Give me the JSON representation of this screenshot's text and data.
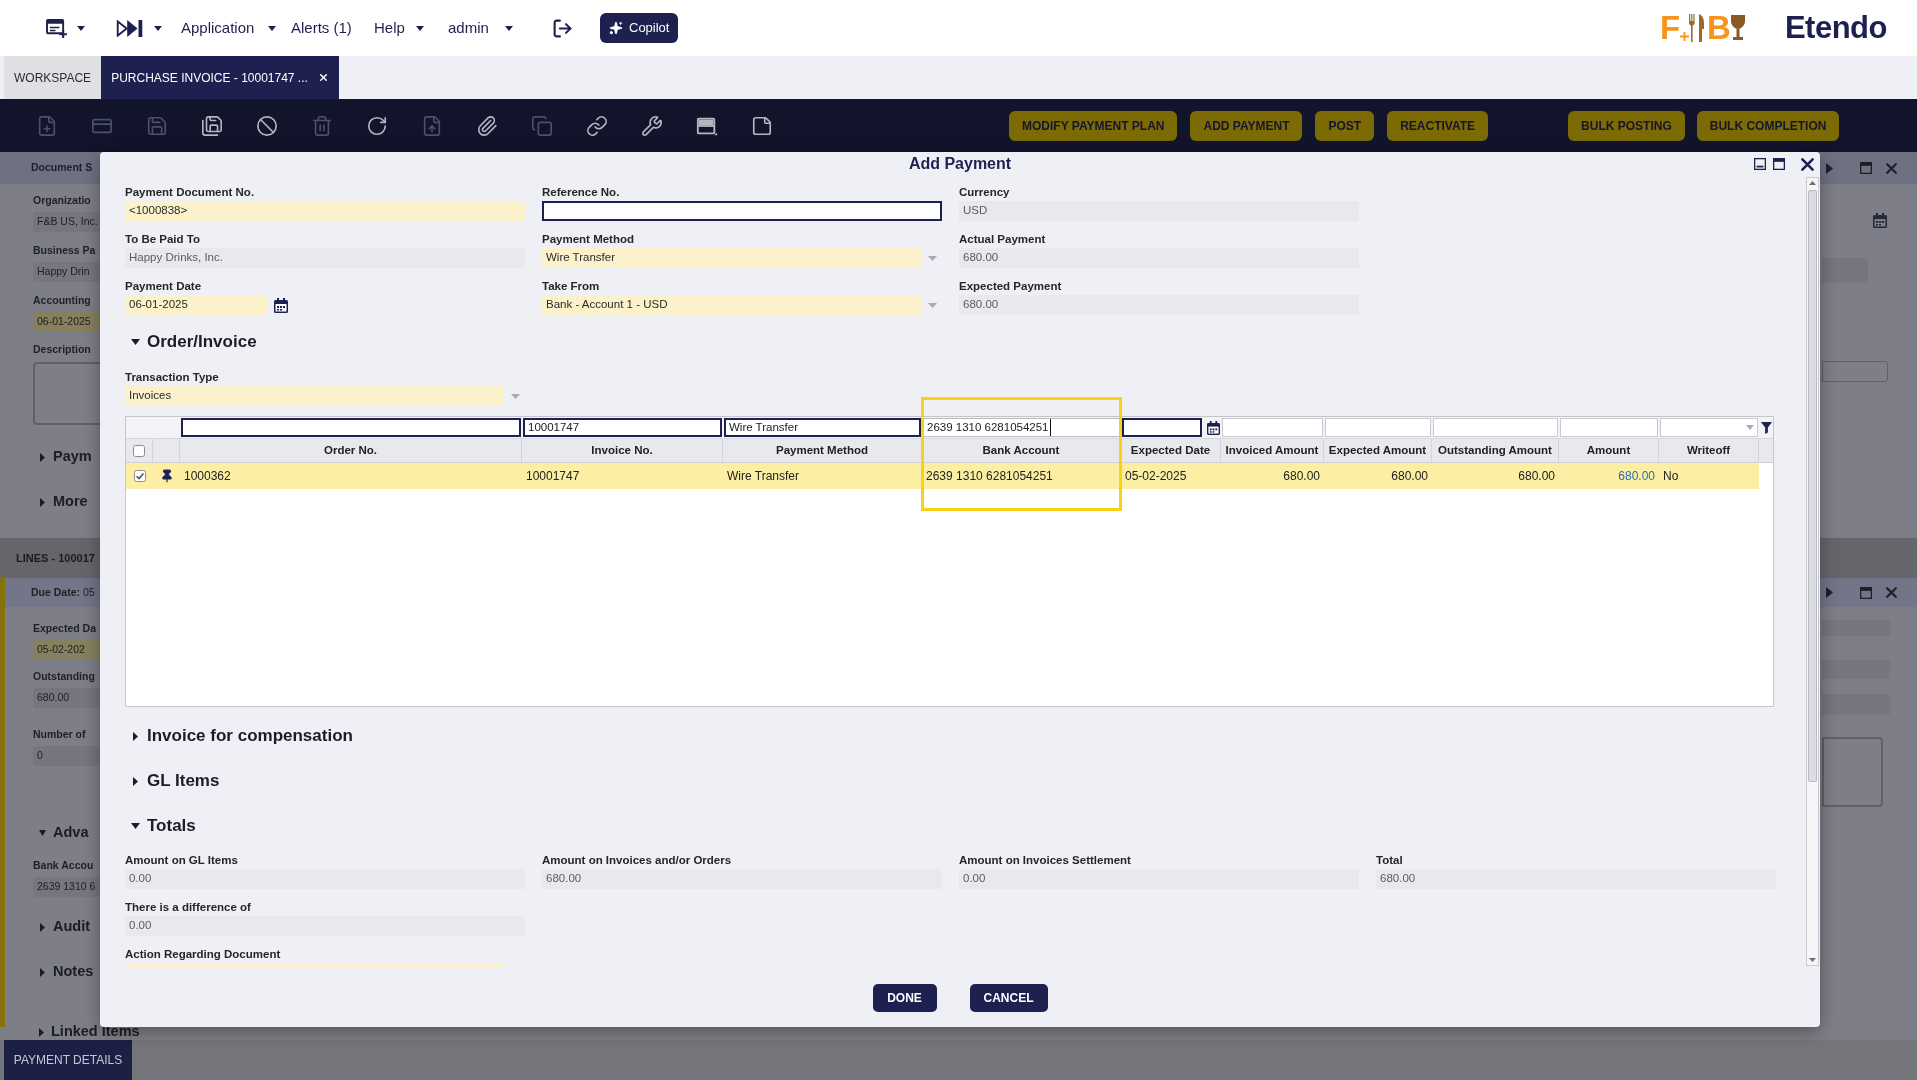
{
  "top_bar": {
    "icon_menus": [
      {
        "dropdown": true
      },
      {
        "dropdown": true
      }
    ],
    "menus": [
      {
        "label": "Application",
        "dropdown": true
      },
      {
        "label": "Alerts (1)",
        "dropdown": false
      },
      {
        "label": "Help",
        "dropdown": true
      },
      {
        "label": "admin",
        "dropdown": true
      }
    ],
    "copilot_button": {
      "label": "Copilot"
    },
    "logo": {
      "letters": [
        "F",
        "B"
      ]
    },
    "brand": "Etendo"
  },
  "tabs": [
    {
      "label": "WORKSPACE",
      "selected": false,
      "closable": false
    },
    {
      "label": "PURCHASE INVOICE - 10001747 ...",
      "selected": true,
      "closable": true
    }
  ],
  "toolbar": {
    "tools": [
      {
        "disabled": true
      },
      {
        "disabled": true
      },
      {
        "disabled": true
      },
      {
        "disabled": false
      },
      {
        "disabled": false
      },
      {
        "disabled": true
      },
      {
        "disabled": false
      },
      {
        "disabled": true
      },
      {
        "disabled": false
      },
      {
        "disabled": true
      },
      {
        "disabled": false
      },
      {
        "disabled": false
      },
      {
        "disabled": false
      },
      {
        "disabled": false
      }
    ],
    "actions": [
      {
        "label": "MODIFY PAYMENT PLAN"
      },
      {
        "label": "ADD PAYMENT"
      },
      {
        "label": "POST"
      },
      {
        "label": "REACTIVATE"
      }
    ],
    "bulk_actions": [
      {
        "label": "BULK POSTING"
      },
      {
        "label": "BULK COMPLETION"
      }
    ]
  },
  "document_panel": {
    "title": "Document S",
    "fields": [
      {
        "label": "Organizatio",
        "value": "F&B US, Inc.",
        "kind": "readonly"
      },
      {
        "label": "Business Pa",
        "value": "Happy Drin",
        "kind": "readonly"
      },
      {
        "label": "Accounting",
        "value": "06-01-2025",
        "kind": "required"
      },
      {
        "label": "Description",
        "kind": "textarea"
      }
    ],
    "sections": [
      {
        "title": "Paym",
        "expanded": false
      },
      {
        "title": "More",
        "expanded": false
      }
    ]
  },
  "lines_panel": {
    "title": "LINES - 100017",
    "subtitle": "**Due Date:** 05",
    "fields": [
      {
        "label": "Expected Da",
        "value": "05-02-202",
        "kind": "required"
      },
      {
        "label": "Outstanding",
        "value": "680.00",
        "kind": "readonly"
      },
      {
        "label": "Number of",
        "value": "0",
        "kind": "readonly"
      }
    ],
    "sections": [
      {
        "title": "Adva",
        "expanded": true,
        "fields": [
          {
            "label": "Bank Accou",
            "value": "2639 1310 6",
            "kind": "readonly"
          }
        ]
      },
      {
        "title": "Audit",
        "expanded": false
      },
      {
        "title": "Notes",
        "expanded": false
      },
      {
        "title": "Linked Items",
        "expanded": false
      }
    ]
  },
  "bottom_tabs": [
    {
      "label": "PAYMENT DETAILS",
      "selected": true
    }
  ],
  "dialog": {
    "title": "Add Payment",
    "fields": [
      {
        "label": "Payment Document No.",
        "value": "<1000838>",
        "kind": "text",
        "required": true,
        "readonly": false
      },
      {
        "label": "Reference No.",
        "kind": "text",
        "required": false,
        "readonly": false
      },
      {
        "label": "Currency",
        "value": "USD",
        "kind": "text",
        "required": false,
        "readonly": true
      },
      {
        "label": "To Be Paid To",
        "value": "Happy Drinks, Inc.",
        "kind": "text",
        "required": false,
        "readonly": true
      },
      {
        "label": "Payment Method",
        "value": "Wire Transfer",
        "kind": "select",
        "required": true,
        "readonly": false
      },
      {
        "label": "Actual Payment",
        "value": "680.00",
        "kind": "text",
        "required": false,
        "readonly": true
      },
      {
        "label": "Payment Date",
        "value": "06-01-2025",
        "kind": "date",
        "required": true,
        "readonly": false
      },
      {
        "label": "Take From",
        "value": "Bank - Account 1 - USD",
        "kind": "select",
        "required": true,
        "readonly": false
      },
      {
        "label": "Expected Payment",
        "value": "680.00",
        "kind": "text",
        "required": false,
        "readonly": true
      }
    ],
    "order_invoice": {
      "title": "Order/Invoice",
      "expanded": true,
      "transaction_type": {
        "label": "Transaction Type",
        "value": "Invoices",
        "kind": "select",
        "required": true,
        "readonly": false
      },
      "grid": {
        "filters": [
          {
            "kind": "text",
            "focused": false
          },
          {
            "kind": "text",
            "value": "10001747",
            "focused": false
          },
          {
            "kind": "text",
            "value": "Wire Transfer",
            "focused": false
          },
          {
            "kind": "text",
            "value": "2639 1310 6281054251",
            "focused": true
          },
          {
            "kind": "date",
            "focused": false
          },
          {
            "kind": "number",
            "focused": false
          },
          {
            "kind": "number",
            "focused": false
          },
          {
            "kind": "number",
            "focused": false
          },
          {
            "kind": "number",
            "focused": false
          },
          {
            "kind": "select",
            "focused": false
          }
        ],
        "all_checked": false,
        "columns": [
          {
            "label": "Order No.",
            "numeric": false,
            "editable": false,
            "highlighted": false
          },
          {
            "label": "Invoice No.",
            "numeric": false,
            "editable": false,
            "highlighted": false
          },
          {
            "label": "Payment Method",
            "numeric": false,
            "editable": false,
            "highlighted": false
          },
          {
            "label": "Bank Account",
            "numeric": false,
            "editable": false,
            "highlighted": true
          },
          {
            "label": "Expected Date",
            "numeric": false,
            "editable": false,
            "highlighted": false
          },
          {
            "label": "Invoiced Amount",
            "numeric": true,
            "editable": false,
            "highlighted": false
          },
          {
            "label": "Expected Amount",
            "numeric": true,
            "editable": false,
            "highlighted": false
          },
          {
            "label": "Outstanding Amount",
            "numeric": true,
            "editable": false,
            "highlighted": false
          },
          {
            "label": "Amount",
            "numeric": true,
            "editable": true,
            "highlighted": false
          },
          {
            "label": "Writeoff",
            "numeric": false,
            "editable": false,
            "highlighted": false
          }
        ],
        "rows": [
          {
            "selected": true,
            "checked": true,
            "pinned": true,
            "cells": [
              "1000362",
              "10001747",
              "Wire Transfer",
              "2639 1310 6281054251",
              "05-02-2025",
              "680.00",
              "680.00",
              "680.00",
              "680.00",
              "No"
            ]
          }
        ]
      }
    },
    "sections": [
      {
        "title": "Invoice for compensation",
        "expanded": false
      },
      {
        "title": "GL Items",
        "expanded": false
      }
    ],
    "totals": {
      "title": "Totals",
      "expanded": true,
      "fields": [
        {
          "label": "Amount on GL Items",
          "value": "0.00"
        },
        {
          "label": "Amount on Invoices and/or Orders",
          "value": "680.00"
        },
        {
          "label": "Amount on Invoices Settlement",
          "value": "0.00"
        },
        {
          "label": "Total",
          "value": "680.00"
        },
        {
          "label": "There is a difference of",
          "value": "0.00"
        }
      ],
      "action_field": {
        "label": "Action Regarding Document",
        "required": true
      }
    },
    "buttons": [
      {
        "label": "DONE"
      },
      {
        "label": "CANCEL"
      }
    ]
  }
}
